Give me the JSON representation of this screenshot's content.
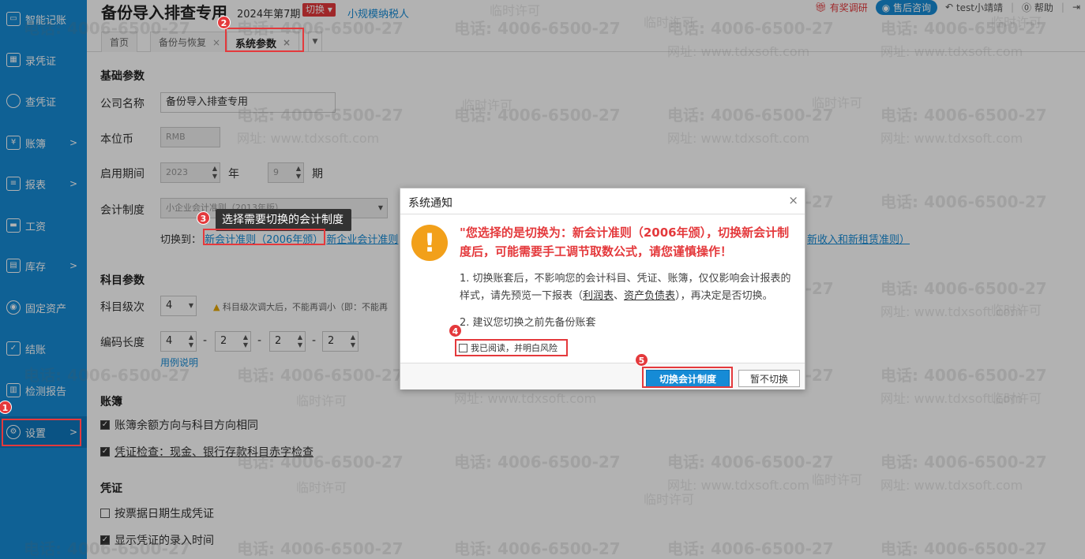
{
  "sidebar": {
    "items": [
      {
        "label": "智能记账",
        "icon": "monitor-icon",
        "has_arrow": false
      },
      {
        "label": "录凭证",
        "icon": "voucher-entry-icon",
        "has_arrow": false
      },
      {
        "label": "查凭证",
        "icon": "search-icon",
        "has_arrow": false
      },
      {
        "label": "账簿",
        "icon": "yen-icon",
        "has_arrow": true
      },
      {
        "label": "报表",
        "icon": "report-icon",
        "has_arrow": true
      },
      {
        "label": "工资",
        "icon": "wallet-icon",
        "has_arrow": false
      },
      {
        "label": "库存",
        "icon": "inventory-icon",
        "has_arrow": true
      },
      {
        "label": "固定资产",
        "icon": "asset-icon",
        "has_arrow": false
      },
      {
        "label": "结账",
        "icon": "checkmark-icon",
        "has_arrow": false
      },
      {
        "label": "检测报告",
        "icon": "chart-report-icon",
        "has_arrow": false
      },
      {
        "label": "设置",
        "icon": "gear-icon",
        "has_arrow": true,
        "active": true
      }
    ],
    "arrow": ">"
  },
  "header": {
    "title": "备份导入排查专用",
    "period": "2024年第7期",
    "switch_label": "切换",
    "taxpayer": "小规模纳税人",
    "right": {
      "survey": "有奖调研",
      "service": "售后咨询",
      "user": "test小靖靖",
      "help": "帮助"
    }
  },
  "tabs": [
    {
      "label": "首页"
    },
    {
      "label": "备份与恢复",
      "close": "×"
    },
    {
      "label": "系统参数",
      "close": "×",
      "active": true
    }
  ],
  "main": {
    "basic_title": "基础参数",
    "company_label": "公司名称",
    "company_value": "备份导入排查专用",
    "currency_label": "本位币",
    "currency_value": "RMB",
    "start_label": "启用期间",
    "start_year": "2023",
    "year_unit": "年",
    "start_period": "9",
    "period_unit": "期",
    "system_label": "会计制度",
    "system_value": "小企业会计准则（2013年版）",
    "switch_to_label": "切换到：",
    "switch_option1": "新会计准则（2006年颁）",
    "switch_option2": "新企业会计准则",
    "switch_option3": "新收入和新租赁准则）",
    "subject_title": "科目参数",
    "level_label": "科目级次",
    "level_value": "4",
    "level_note": "科目级次调大后，不能再调小（即：不能再",
    "code_label": "编码长度",
    "code_values": [
      "4",
      "2",
      "2",
      "2"
    ],
    "code_dash": "-",
    "code_help": "用例说明",
    "ledger_title": "账簿",
    "ledger_opt1": "账簿余额方向与科目方向相同",
    "ledger_opt2": "凭证检查：现金、银行存款科目赤字检查",
    "voucher_title": "凭证",
    "voucher_opt1": "按票据日期生成凭证",
    "voucher_opt2": "显示凭证的录入时间"
  },
  "tooltip": "选择需要切换的会计制度",
  "annotations": [
    "1",
    "2",
    "3",
    "4",
    "5"
  ],
  "dialog": {
    "title": "系统通知",
    "close": "×",
    "icon_glyph": "!",
    "warning": "\"您选择的是切换为：新会计准则（2006年颁），切换新会计制度后，可能需要手工调节取数公式，请您谨慎操作！",
    "para1_a": "1. 切换账套后，不影响您的会计科目、凭证、账簿，仅仅影响会计报表的样式，请先预览一下报表（",
    "para1_link1": "利润表",
    "para1_sep": "、",
    "para1_link2": "资产负债表",
    "para1_b": "），再决定是否切换。",
    "para2": "2. 建议您切换之前先备份账套",
    "checkbox_label": "我已阅读，并明白风险",
    "confirm": "切换会计制度",
    "cancel": "暂不切换"
  },
  "watermark": {
    "phone": "电话: 4006-6500-27",
    "site": "网址: www.tdxsoft.com",
    "license": "临时许可"
  },
  "colors": {
    "sidebar": "#168bd6",
    "accent_red": "#e4393c",
    "warning_orange": "#f2a01a"
  }
}
